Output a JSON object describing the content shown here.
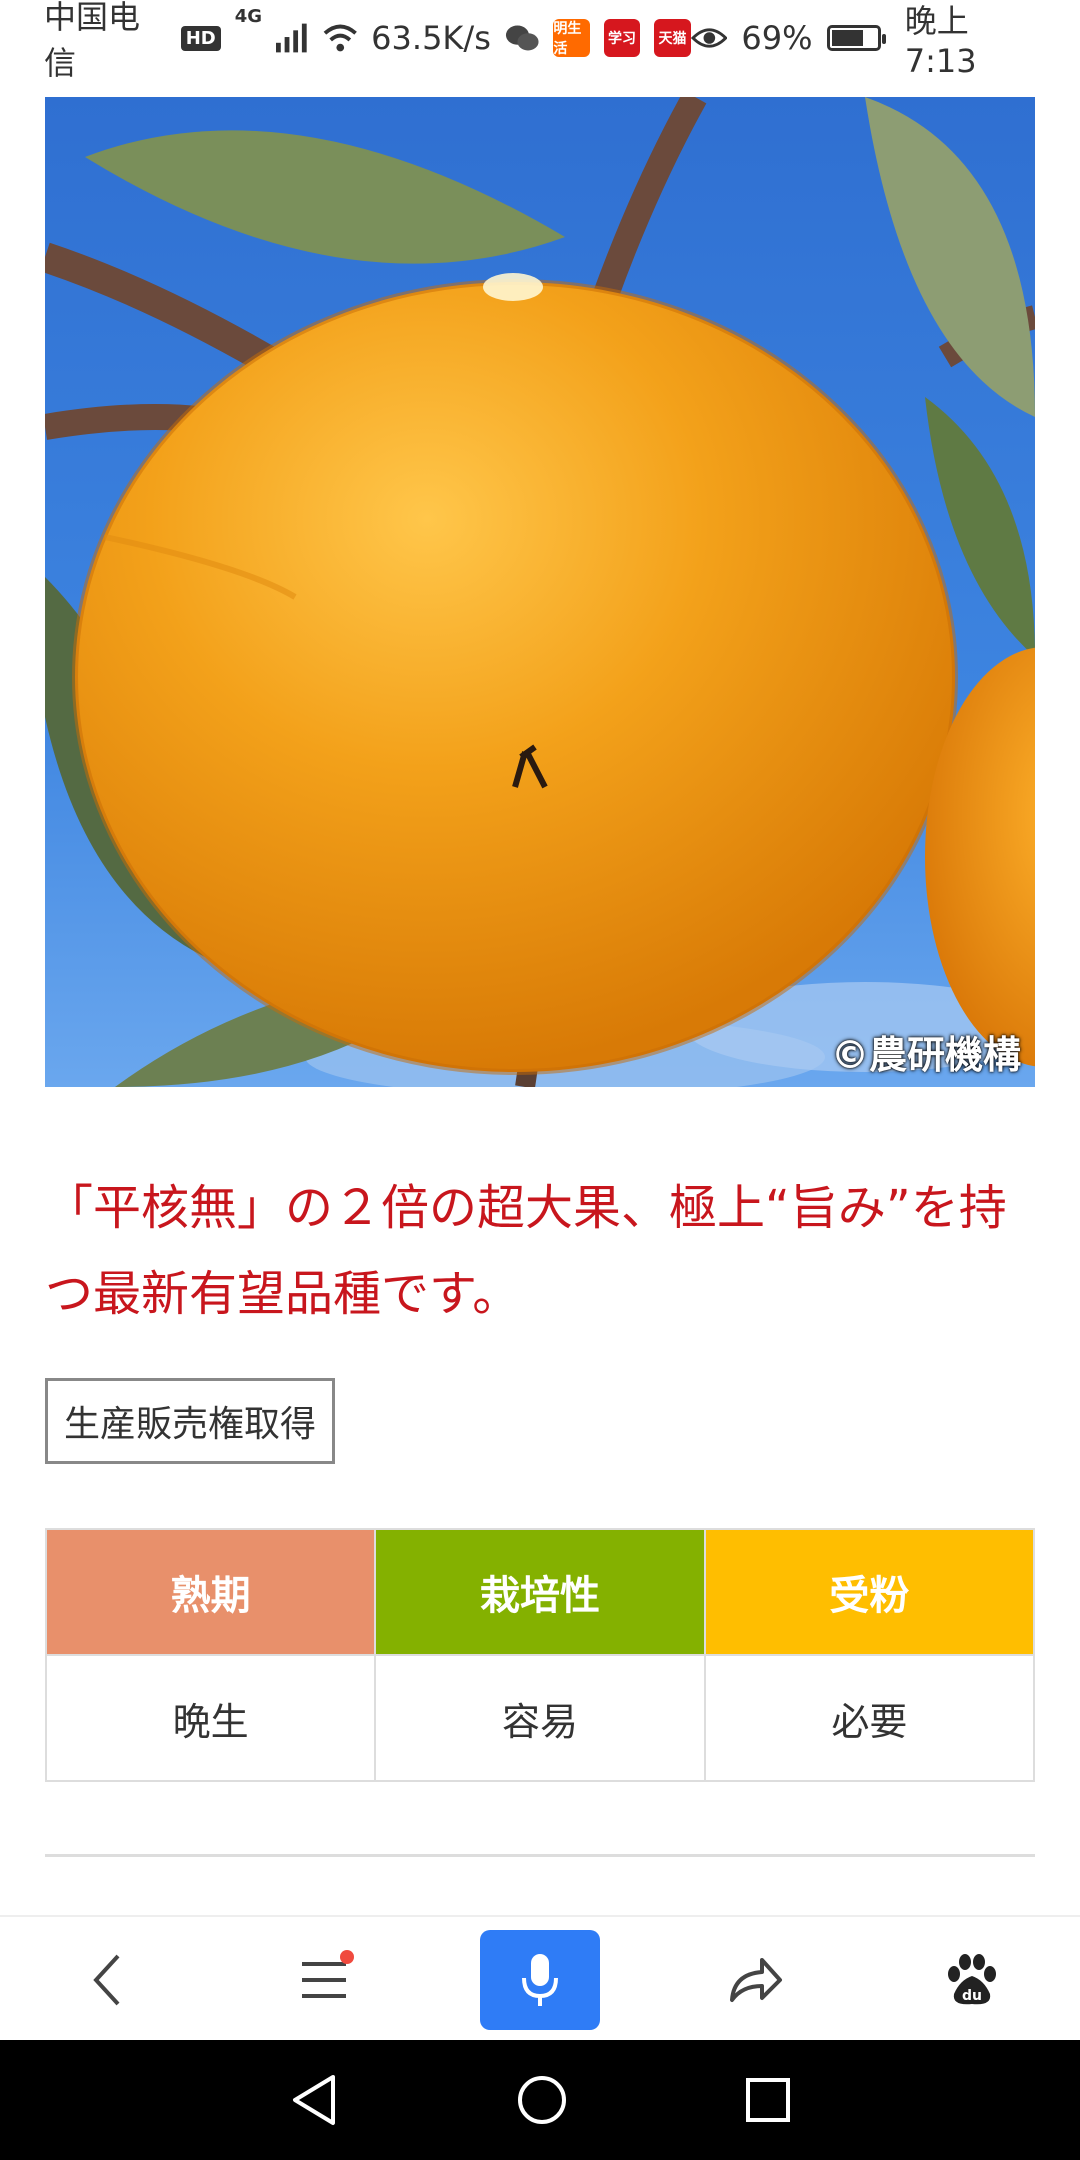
{
  "status_bar": {
    "carrier": "中国电信",
    "hd": "HD",
    "network": "4G",
    "speed": "63.5K/s",
    "app_badges": [
      "明生活",
      "学习",
      "天猫"
    ],
    "battery": "69%",
    "battery_level": 0.69,
    "time": "晚上7:13"
  },
  "photo": {
    "copyright": "©農研機構"
  },
  "headline": "「平核無」の２倍の超大果、極上“旨み”を持つ最新有望品種です。",
  "tag": "生産販売権取得",
  "spec_table": {
    "headers": [
      {
        "label": "熟期",
        "color": "#e8906b"
      },
      {
        "label": "栽培性",
        "color": "#84b100"
      },
      {
        "label": "受粉",
        "color": "#ffbe00"
      }
    ],
    "values": [
      "晩生",
      "容易",
      "必要"
    ]
  },
  "bottom_bar": {
    "mic_color": "#2f7cf6",
    "notify_dot_color": "#f04a3e"
  }
}
